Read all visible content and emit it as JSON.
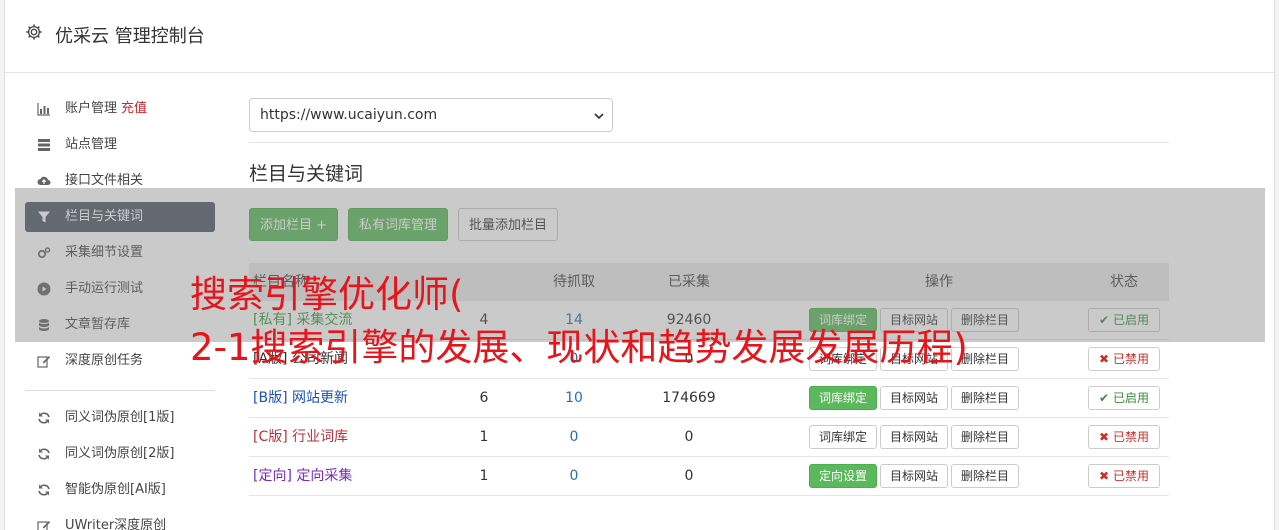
{
  "header": {
    "title": "优采云 管理控制台",
    "icon": "gear-icon"
  },
  "sidebar": {
    "items": [
      {
        "label": "账户管理",
        "badge": "充值",
        "icon": "bar-chart-icon"
      },
      {
        "label": "站点管理",
        "icon": "server-icon"
      },
      {
        "label": "接口文件相关",
        "icon": "cloud-upload-icon"
      },
      {
        "label": "栏目与关键词",
        "icon": "filter-icon",
        "active": true
      },
      {
        "label": "采集细节设置",
        "icon": "cogs-icon"
      },
      {
        "label": "手动运行测试",
        "icon": "play-circle-icon"
      },
      {
        "label": "文章暂存库",
        "icon": "database-icon"
      },
      {
        "label": "深度原创任务",
        "icon": "edit-icon"
      }
    ],
    "items2": [
      {
        "label": "同义词伪原创[1版]",
        "icon": "refresh-icon"
      },
      {
        "label": "同义词伪原创[2版]",
        "icon": "refresh-icon"
      },
      {
        "label": "智能伪原创[AI版]",
        "icon": "refresh-icon"
      },
      {
        "label": "UWriter深度原创",
        "icon": "edit-icon"
      }
    ]
  },
  "main": {
    "site_select": "https://www.ucaiyun.com",
    "section_title": "栏目与关键词",
    "buttons": {
      "add_column": "添加栏目 +",
      "private_lib": "私有词库管理",
      "batch_add": "批量添加栏目"
    },
    "table": {
      "headers": {
        "name": "栏目名称",
        "col2": "",
        "pending": "待抓取",
        "collected": "已采集",
        "ops": "操作",
        "status": "状态"
      },
      "rows": [
        {
          "tag": "[私有]",
          "name": "采集交流",
          "color": "#3c9a3c",
          "n1": "4",
          "n2": "14",
          "n3": "92460",
          "op1": "词库绑定",
          "op1_green": true,
          "op2": "目标网站",
          "op3": "删除栏目",
          "status": "已启用",
          "on": true
        },
        {
          "tag": "[A版]",
          "name": "公司新闻",
          "color": "#333333",
          "n1": "",
          "n2": "0",
          "n3": "0",
          "op1": "词库绑定",
          "op1_green": false,
          "op2": "目标网站",
          "op3": "删除栏目",
          "status": "已禁用",
          "on": false
        },
        {
          "tag": "[B版]",
          "name": "网站更新",
          "color": "#1e4fc0",
          "n1": "6",
          "n2": "10",
          "n3": "174669",
          "op1": "词库绑定",
          "op1_green": true,
          "op2": "目标网站",
          "op3": "删除栏目",
          "status": "已启用",
          "on": true
        },
        {
          "tag": "[C版]",
          "name": "行业词库",
          "color": "#b8323c",
          "n1": "1",
          "n2": "0",
          "n3": "0",
          "op1": "词库绑定",
          "op1_green": false,
          "op2": "目标网站",
          "op3": "删除栏目",
          "status": "已禁用",
          "on": false
        },
        {
          "tag": "[定向]",
          "name": "定向采集",
          "color": "#7a2ac0",
          "n1": "1",
          "n2": "0",
          "n3": "0",
          "op1": "定向设置",
          "op1_green": true,
          "op2": "目标网站",
          "op3": "删除栏目",
          "status": "已禁用",
          "on": false
        }
      ]
    }
  },
  "overlay": {
    "line1": "搜索引擎优化师(",
    "line2": "2-1搜索引擎的发展、现状和趋势发展发展历程)"
  }
}
